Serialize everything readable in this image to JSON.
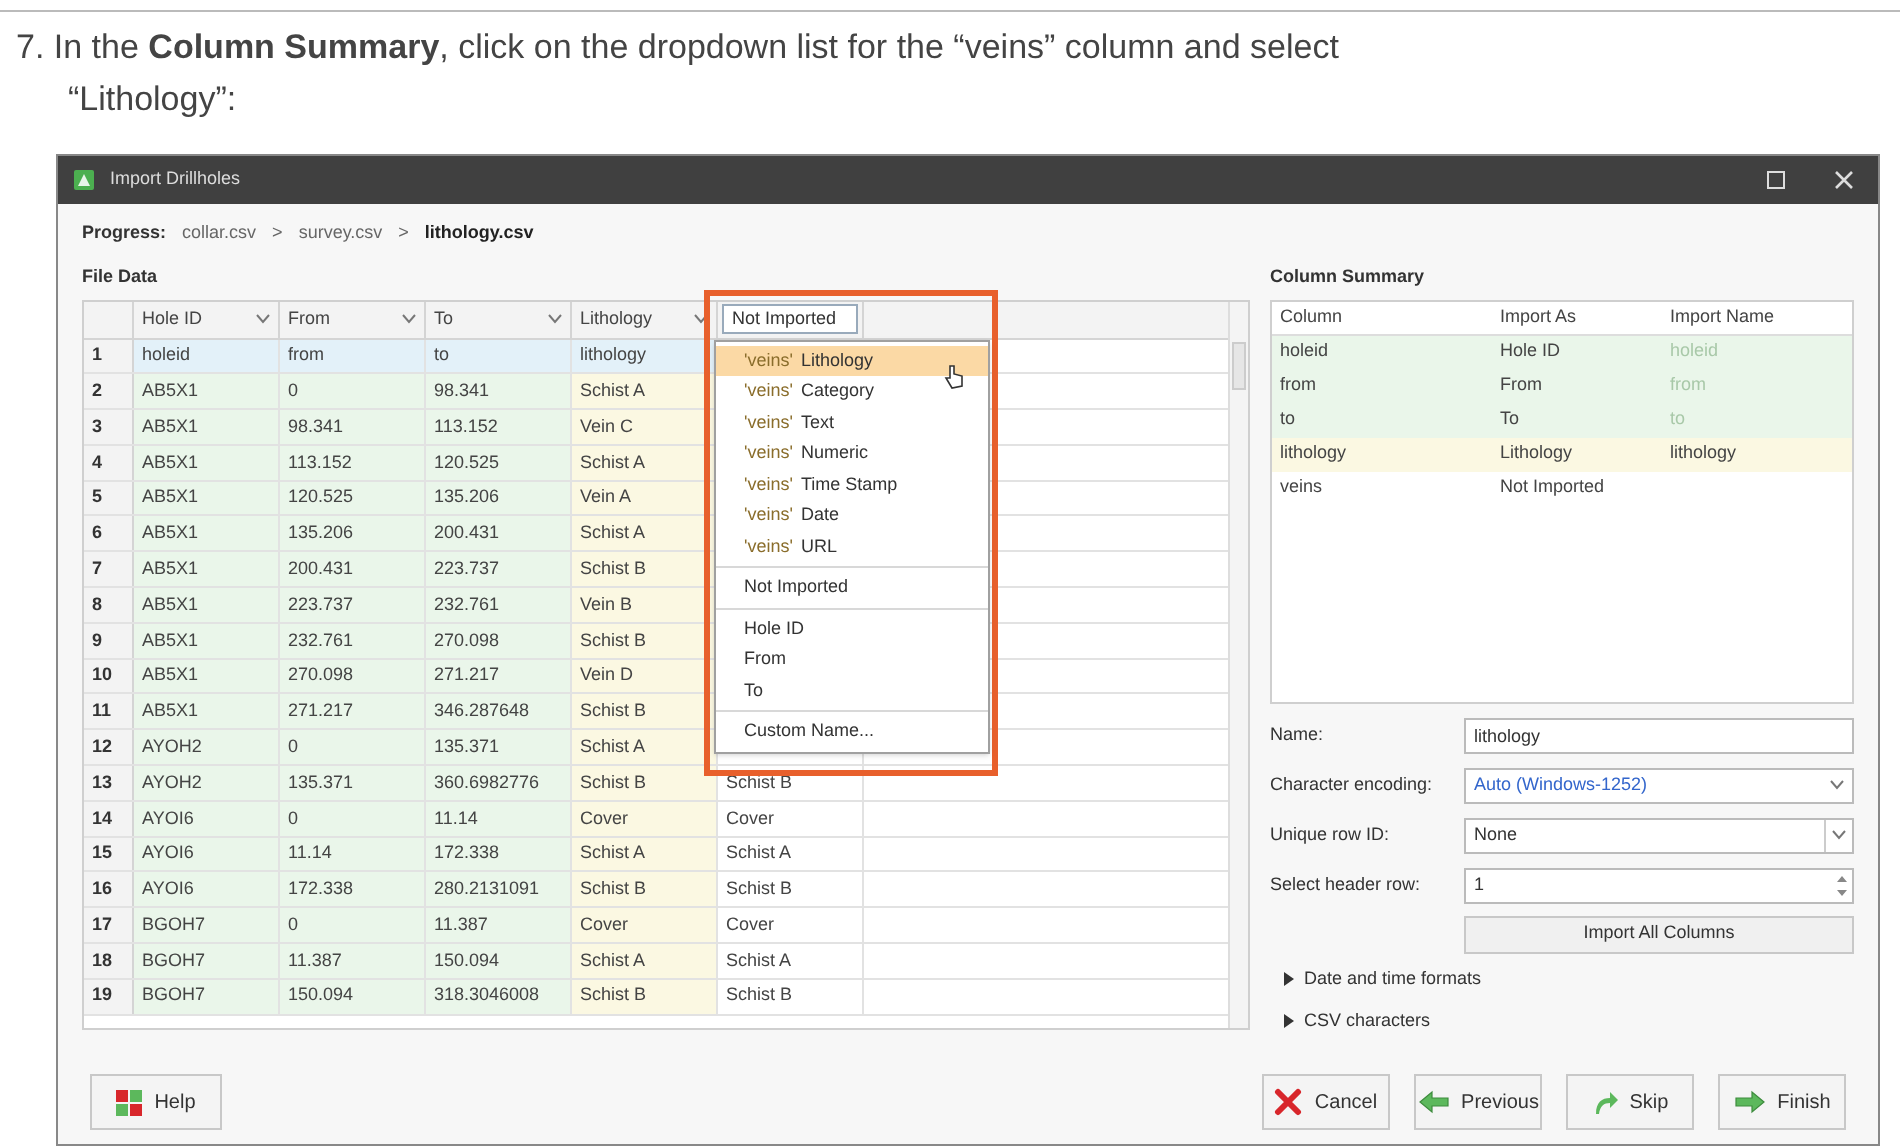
{
  "instruction": "7. In the **Column Summary**, click on the dropdown list for the “veins” column and select “Lithology”:",
  "window": {
    "title": "Import Drillholes"
  },
  "progress": {
    "label": "Progress:",
    "separators": [
      ">",
      ">"
    ],
    "steps": [
      {
        "name": "collar.csv",
        "current": false
      },
      {
        "name": "survey.csv",
        "current": false
      },
      {
        "name": "lithology.csv",
        "current": true
      }
    ]
  },
  "file_data": {
    "label": "File Data",
    "columns": [
      {
        "label": "Hole ID",
        "kind": "sort",
        "color": "#eaf6ea"
      },
      {
        "label": "From",
        "kind": "sort",
        "color": "#eaf6ea"
      },
      {
        "label": "To",
        "kind": "sort",
        "color": "#eaf6ea"
      },
      {
        "label": "Lithology",
        "kind": "sort",
        "color": "#fbf8e2"
      },
      {
        "label": "Not Imported",
        "kind": "combo",
        "color": "#ffffff"
      }
    ],
    "rows": [
      {
        "number": "1",
        "kind": "names",
        "cells": [
          "holeid",
          "from",
          "to",
          "lithology"
        ]
      },
      {
        "number": "2",
        "kind": "data",
        "cells": [
          "AB5X1",
          "0",
          "98.341",
          "Schist A"
        ]
      },
      {
        "number": "3",
        "kind": "data",
        "cells": [
          "AB5X1",
          "98.341",
          "113.152",
          "Vein C"
        ]
      },
      {
        "number": "4",
        "kind": "data",
        "cells": [
          "AB5X1",
          "113.152",
          "120.525",
          "Schist A"
        ]
      },
      {
        "number": "5",
        "kind": "data",
        "cells": [
          "AB5X1",
          "120.525",
          "135.206",
          "Vein A"
        ]
      },
      {
        "number": "6",
        "kind": "data",
        "cells": [
          "AB5X1",
          "135.206",
          "200.431",
          "Schist A"
        ]
      },
      {
        "number": "7",
        "kind": "data",
        "cells": [
          "AB5X1",
          "200.431",
          "223.737",
          "Schist B"
        ]
      },
      {
        "number": "8",
        "kind": "data",
        "cells": [
          "AB5X1",
          "223.737",
          "232.761",
          "Vein B"
        ]
      },
      {
        "number": "9",
        "kind": "data",
        "cells": [
          "AB5X1",
          "232.761",
          "270.098",
          "Schist B"
        ]
      },
      {
        "number": "10",
        "kind": "data",
        "cells": [
          "AB5X1",
          "270.098",
          "271.217",
          "Vein D"
        ]
      },
      {
        "number": "11",
        "kind": "data",
        "cells": [
          "AB5X1",
          "271.217",
          "346.287648",
          "Schist B"
        ]
      },
      {
        "number": "12",
        "kind": "data",
        "cells": [
          "AYOH2",
          "0",
          "135.371",
          "Schist A"
        ]
      },
      {
        "number": "13",
        "kind": "data",
        "cells": [
          "AYOH2",
          "135.371",
          "360.6982776",
          "Schist B",
          "Schist B"
        ]
      },
      {
        "number": "14",
        "kind": "data",
        "cells": [
          "AYOI6",
          "0",
          "11.14",
          "Cover",
          "Cover"
        ]
      },
      {
        "number": "15",
        "kind": "data",
        "cells": [
          "AYOI6",
          "11.14",
          "172.338",
          "Schist A",
          "Schist A"
        ]
      },
      {
        "number": "16",
        "kind": "data",
        "cells": [
          "AYOI6",
          "172.338",
          "280.2131091",
          "Schist B",
          "Schist B"
        ]
      },
      {
        "number": "17",
        "kind": "data",
        "cells": [
          "BGOH7",
          "0",
          "11.387",
          "Cover",
          "Cover"
        ]
      },
      {
        "number": "18",
        "kind": "data",
        "cells": [
          "BGOH7",
          "11.387",
          "150.094",
          "Schist A",
          "Schist A"
        ]
      },
      {
        "number": "19",
        "kind": "data",
        "cells": [
          "BGOH7",
          "150.094",
          "318.3046008",
          "Schist B",
          "Schist B"
        ]
      }
    ],
    "dropdown": {
      "items": [
        {
          "kind": "option",
          "prefix": "'veins'",
          "label": "Lithology",
          "selected": true
        },
        {
          "kind": "option",
          "prefix": "'veins'",
          "label": "Category",
          "selected": false
        },
        {
          "kind": "option",
          "prefix": "'veins'",
          "label": "Text",
          "selected": false
        },
        {
          "kind": "option",
          "prefix": "'veins'",
          "label": "Numeric",
          "selected": false
        },
        {
          "kind": "option",
          "prefix": "'veins'",
          "label": "Time Stamp",
          "selected": false
        },
        {
          "kind": "option",
          "prefix": "'veins'",
          "label": "Date",
          "selected": false
        },
        {
          "kind": "option",
          "prefix": "'veins'",
          "label": "URL",
          "selected": false
        },
        {
          "kind": "separator"
        },
        {
          "kind": "option",
          "label": "Not Imported",
          "selected": false
        },
        {
          "kind": "separator"
        },
        {
          "kind": "option",
          "label": "Hole ID",
          "selected": false
        },
        {
          "kind": "option",
          "label": "From",
          "selected": false
        },
        {
          "kind": "option",
          "label": "To",
          "selected": false
        },
        {
          "kind": "separator"
        },
        {
          "kind": "option",
          "label": "Custom Name...",
          "selected": false
        }
      ]
    }
  },
  "column_summary": {
    "label": "Column Summary",
    "columns": [
      "Column",
      "Import As",
      "Import Name"
    ],
    "rows": [
      {
        "cells": [
          "holeid",
          "Hole ID",
          "holeid"
        ],
        "color": "#eaf6ea",
        "dimmed": true
      },
      {
        "cells": [
          "from",
          "From",
          "from"
        ],
        "color": "#eaf6ea",
        "dimmed": true
      },
      {
        "cells": [
          "to",
          "To",
          "to"
        ],
        "color": "#eaf6ea",
        "dimmed": true
      },
      {
        "cells": [
          "lithology",
          "Lithology",
          "lithology"
        ],
        "color": "#fbf8e2",
        "dimmed": false
      },
      {
        "cells": [
          "veins",
          "Not Imported"
        ],
        "color": "#ffffff"
      }
    ]
  },
  "form": {
    "name": {
      "label": "Name:",
      "value": "lithology"
    },
    "encoding": {
      "label": "Character encoding:",
      "value": "Auto (Windows-1252)"
    },
    "unique_row": {
      "label": "Unique row ID:",
      "value": "None"
    },
    "header_row": {
      "label": "Select header row:",
      "value": "1"
    },
    "import_all": "Import All Columns",
    "expanders": [
      {
        "label": "Date and time formats",
        "expanded": false
      },
      {
        "label": "CSV characters",
        "expanded": false
      }
    ]
  },
  "buttons": {
    "help": "Help",
    "actions": [
      {
        "kind": "cancel",
        "label": "Cancel"
      },
      {
        "kind": "back",
        "label": "Previous"
      },
      {
        "kind": "skip",
        "label": "Skip"
      },
      {
        "kind": "forward",
        "label": "Finish"
      }
    ]
  }
}
